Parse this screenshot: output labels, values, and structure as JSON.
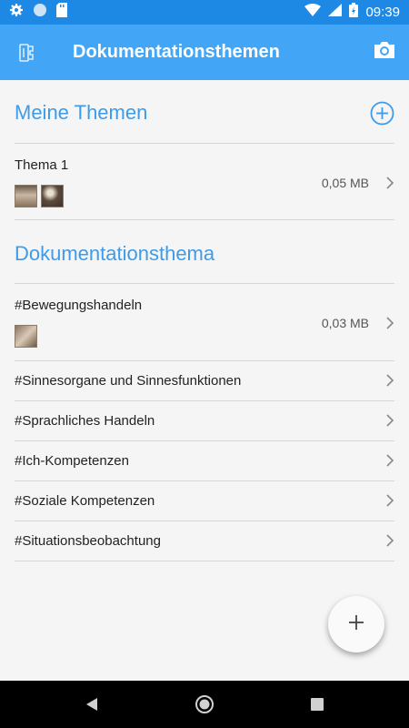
{
  "status_bar": {
    "time": "09:39"
  },
  "app_bar": {
    "title": "Dokumentationsthemen"
  },
  "sections": [
    {
      "title": "Meine Themen",
      "items": [
        {
          "title": "Thema 1",
          "size": "0,05 MB",
          "thumbnail_count": 2
        }
      ]
    },
    {
      "title": "Dokumentationsthema",
      "items": [
        {
          "title": "#Bewegungshandeln",
          "size": "0,03 MB",
          "thumbnail_count": 1
        },
        {
          "title": "#Sinnesorgane und Sinnesfunktionen"
        },
        {
          "title": "#Sprachliches Handeln"
        },
        {
          "title": "#Ich-Kompetenzen"
        },
        {
          "title": "#Soziale Kompetenzen"
        },
        {
          "title": "#Situationsbeobachtung"
        }
      ]
    }
  ],
  "fab": {
    "icon": "plus-icon"
  },
  "colors": {
    "status_bar": "#1e88e5",
    "app_bar": "#42a5f5",
    "accent": "#3d9be9",
    "background": "#f5f5f5"
  }
}
